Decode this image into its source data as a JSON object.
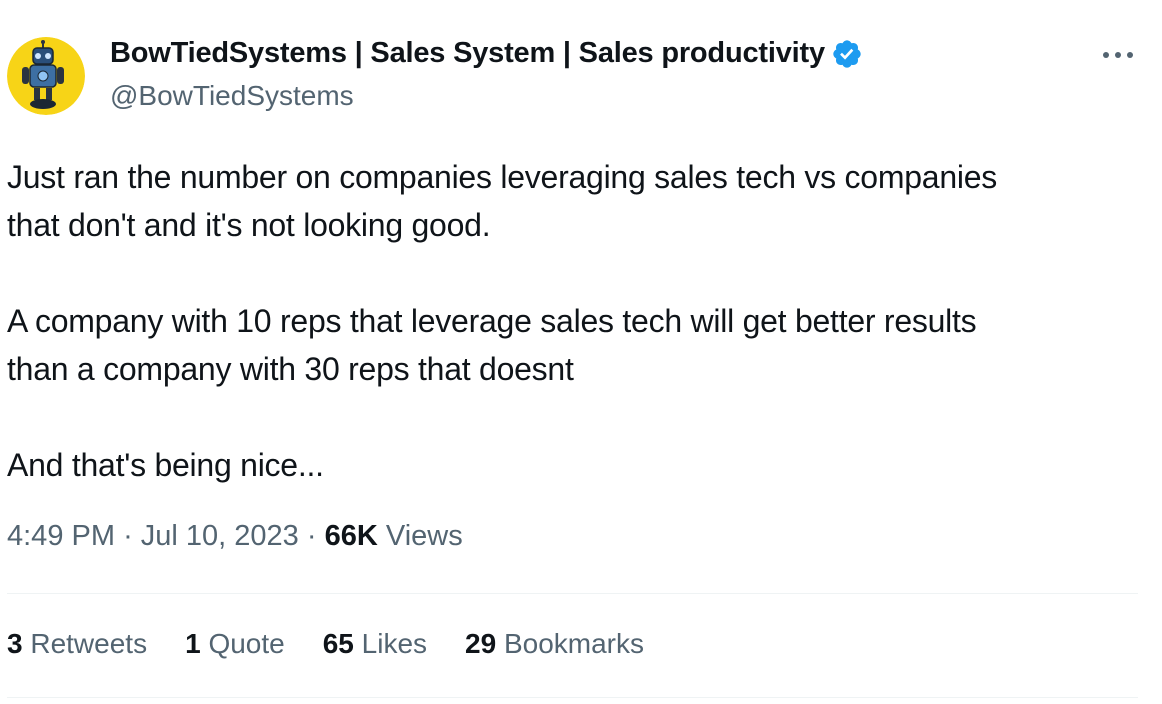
{
  "author": {
    "name": "BowTiedSystems | Sales System | Sales productivity",
    "handle": "@BowTiedSystems",
    "verified_icon": "verified-badge-icon",
    "avatar_icon": "robot-avatar-icon"
  },
  "more_icon": "more-horizontal-icon",
  "tweet": {
    "lines": [
      "Just ran the number on companies leveraging sales tech vs companies",
      "that don't and it's not looking good.",
      "A company with 10 reps that leverage sales tech will get better results",
      "than a company with 30 reps that doesnt",
      "And that's being nice..."
    ]
  },
  "meta": {
    "time": "4:49 PM",
    "separator1": "·",
    "date": "Jul 10, 2023",
    "separator2": "·",
    "views_count": "66K",
    "views_label": "Views"
  },
  "stats": {
    "retweets_count": "3",
    "retweets_label": "Retweets",
    "quotes_count": "1",
    "quotes_label": "Quote",
    "likes_count": "65",
    "likes_label": "Likes",
    "bookmarks_count": "29",
    "bookmarks_label": "Bookmarks"
  },
  "colors": {
    "text_primary": "#0f1419",
    "text_secondary": "#536471",
    "verified_blue": "#1d9bf0",
    "avatar_yellow": "#f7d417",
    "divider": "#eff3f4"
  }
}
